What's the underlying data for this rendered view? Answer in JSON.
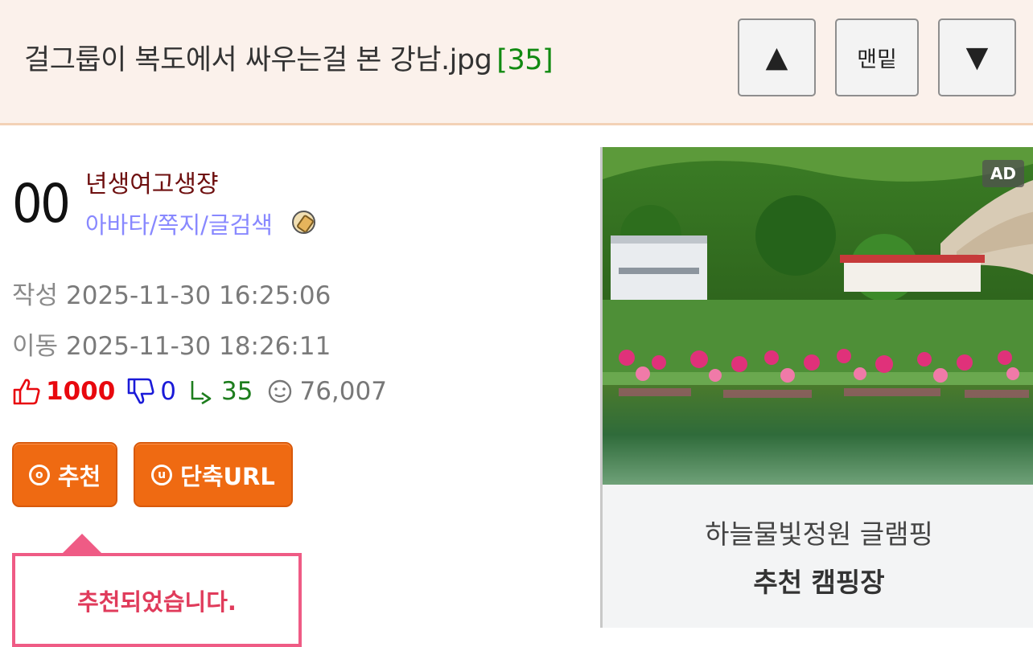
{
  "header": {
    "title": "걸그룹이 복도에서 싸우는걸 본 강남.jpg",
    "comment_count": "[35]",
    "nav_up_label": "▲",
    "nav_bottom_label": "맨밑",
    "nav_down_label": "▼"
  },
  "author": {
    "number": "00",
    "nickname": "년생여고생쟝",
    "links": "아바타/쪽지/글검색",
    "medal_icon": "medal-icon"
  },
  "meta": {
    "written_label": "작성",
    "written_time": "2025-11-30 16:25:06",
    "moved_label": "이동",
    "moved_time": "2025-11-30 18:26:11"
  },
  "stats": {
    "upvotes": "1000",
    "downvotes": "0",
    "replies": "35",
    "views": "76,007",
    "colors": {
      "up": "#e8080e",
      "down": "#1a1ad8",
      "reply": "#1d7d1d",
      "view": "#777777"
    }
  },
  "buttons": {
    "recommend_icon": "ⓞ",
    "recommend_label": "추천",
    "shorturl_icon": "ⓤ",
    "shorturl_label": "단축URL",
    "accent": "#ef6a12"
  },
  "toast": {
    "message": "추천되었습니다."
  },
  "ad": {
    "badge": "AD",
    "line1": "하늘물빛정원 글램핑",
    "line2": "추천 캠핑장"
  }
}
